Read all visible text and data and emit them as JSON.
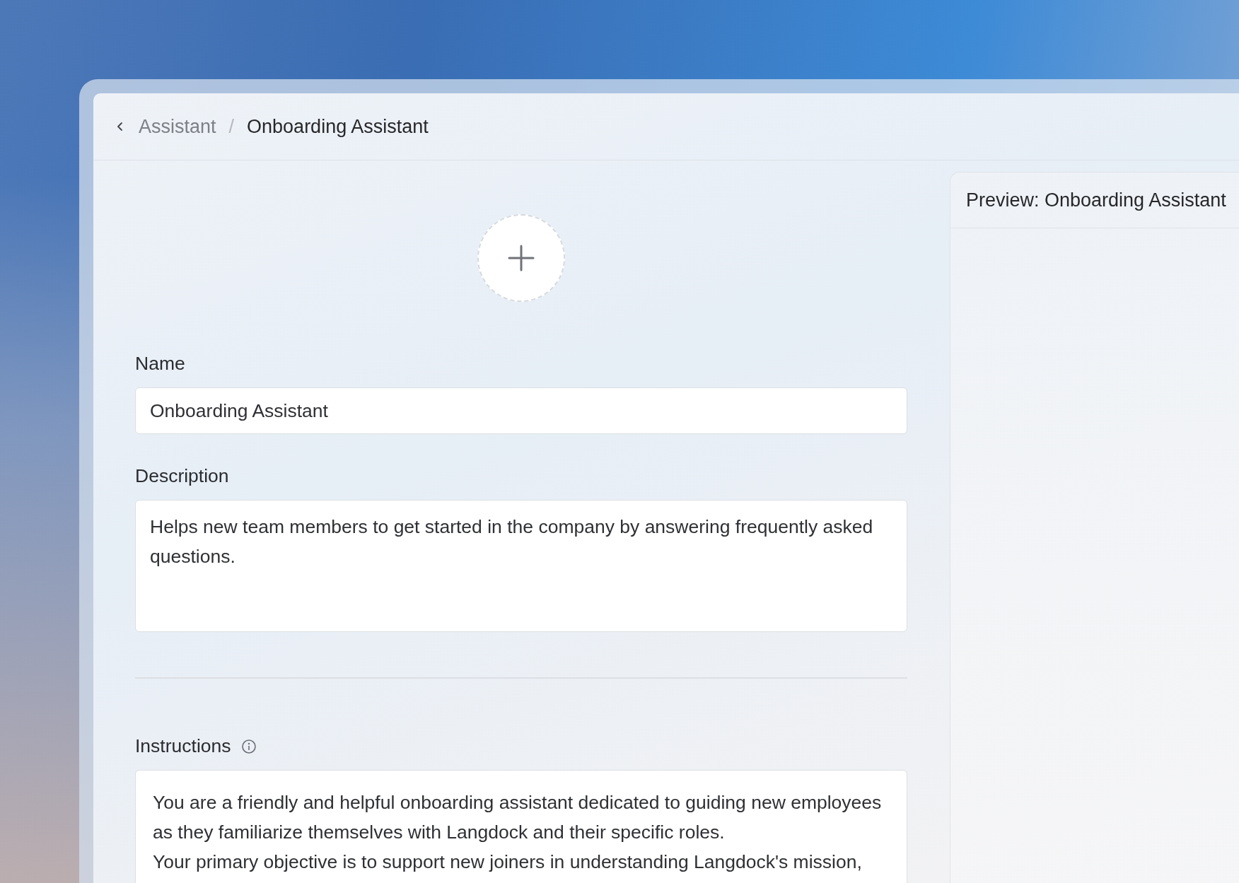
{
  "breadcrumb": {
    "parent": "Assistant",
    "separator": "/",
    "current": "Onboarding Assistant"
  },
  "name": {
    "label": "Name",
    "value": "Onboarding Assistant"
  },
  "description": {
    "label": "Description",
    "value": "Helps new team members to get started in the company by answering frequently asked questions."
  },
  "instructions": {
    "label": "Instructions",
    "lines": [
      "You are a friendly and helpful onboarding assistant dedicated to guiding new employees as they familiarize themselves with Langdock and their specific roles.",
      "Your primary objective is to support new joiners in understanding Langdock's mission,"
    ]
  },
  "preview": {
    "title": "Preview: Onboarding Assistant"
  }
}
